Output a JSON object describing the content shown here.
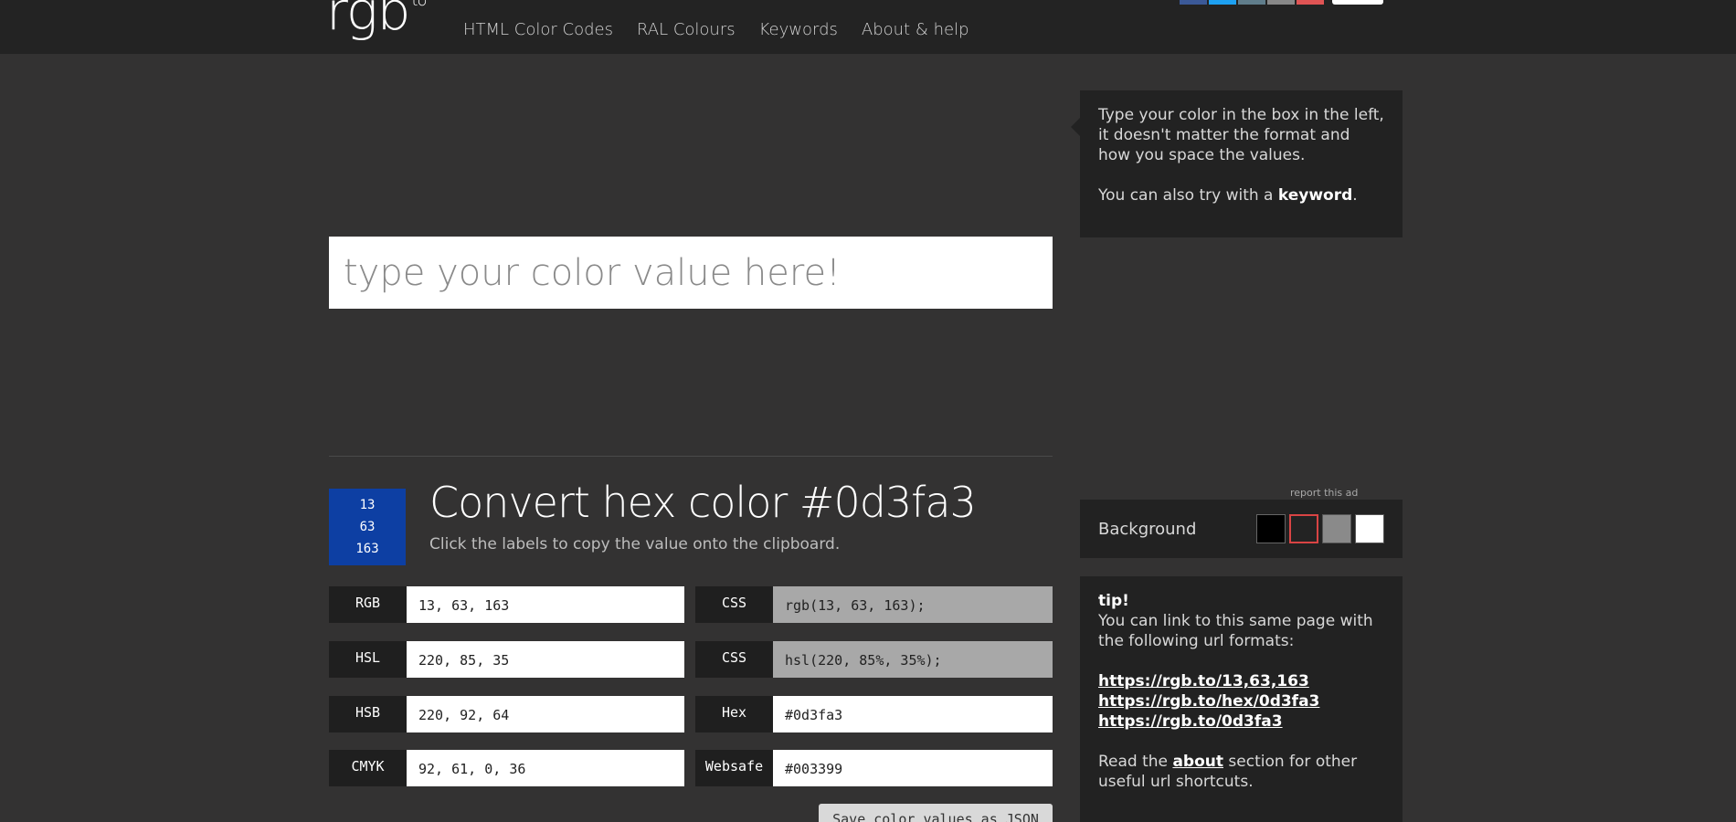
{
  "header": {
    "logo": "rgb",
    "logo_sup": "to",
    "nav": [
      "HTML Color Codes",
      "RAL Colours",
      "Keywords",
      "About & help"
    ]
  },
  "search": {
    "placeholder": "type your color value here!"
  },
  "result": {
    "swatch_color": "#0d3fa3",
    "swatch_values": [
      "13",
      "63",
      "163"
    ],
    "title": "Convert hex color #0d3fa3",
    "subtitle": "Click the labels to copy the value onto the clipboard."
  },
  "values_left": [
    {
      "label": "RGB",
      "value": "13, 63, 163"
    },
    {
      "label": "HSL",
      "value": "220, 85, 35"
    },
    {
      "label": "HSB",
      "value": "220, 92, 64"
    },
    {
      "label": "CMYK",
      "value": "92, 61, 0, 36"
    }
  ],
  "values_right": [
    {
      "label": "CSS",
      "value": "rgb(13, 63, 163);",
      "grey": true
    },
    {
      "label": "CSS",
      "value": "hsl(220, 85%, 35%);",
      "grey": true
    },
    {
      "label": "Hex",
      "value": "#0d3fa3",
      "grey": false
    },
    {
      "label": "Websafe",
      "value": "#003399",
      "grey": false
    }
  ],
  "save_button": "Save color values as JSON",
  "help": {
    "text1": "Type your color in the box in the left, it doesn't matter the format and how you space the values.",
    "text2_prefix": "You can also try with a ",
    "text2_link": "keyword",
    "text2_suffix": "."
  },
  "report_ad": "report this ad",
  "background": {
    "label": "Background",
    "options": [
      "#000000",
      "#232323",
      "#8a8a8a",
      "#ffffff"
    ],
    "selected": "#232323"
  },
  "tip": {
    "title": "tip!",
    "text": "You can link to this same page with the following url formats:",
    "links": [
      "https://rgb.to/13,63,163",
      "https://rgb.to/hex/0d3fa3",
      "https://rgb.to/0d3fa3"
    ],
    "read_prefix": "Read the ",
    "read_link": "about",
    "read_suffix": " section for other useful url shortcuts."
  }
}
